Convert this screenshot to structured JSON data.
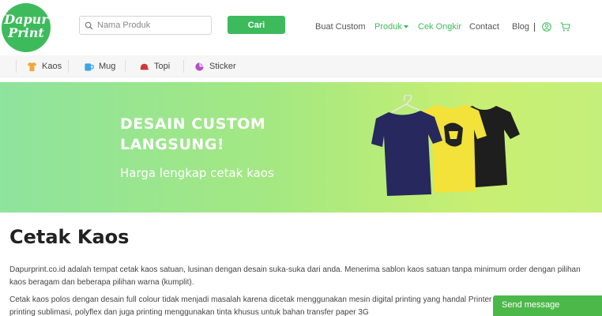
{
  "header": {
    "logo_line1": "Dapur",
    "logo_line2": "Print",
    "search_placeholder": "Nama Produk",
    "search_button": "Cari",
    "nav": [
      {
        "label": "Buat Custom"
      },
      {
        "label": "Produk"
      },
      {
        "label": "Cek Ongkir"
      },
      {
        "label": "Contact"
      },
      {
        "label": "Blog"
      }
    ],
    "accent_color": "#3dbb5c"
  },
  "categories": [
    {
      "label": "Kaos",
      "icon": "tshirt-icon"
    },
    {
      "label": "Mug",
      "icon": "mug-icon"
    },
    {
      "label": "Topi",
      "icon": "cap-icon"
    },
    {
      "label": "Sticker",
      "icon": "sticker-icon"
    }
  ],
  "banner": {
    "title_line1": "DESAIN CUSTOM",
    "title_line2": "LANGSUNG!",
    "subtitle": "Harga lengkap cetak kaos"
  },
  "content": {
    "title": "Cetak Kaos",
    "paragraph1": "Dapurprint.co.id adalah tempat cetak kaos satuan, lusinan dengan desain suka-suka dari anda. Menerima sablon kaos satuan tanpa minimum order dengan pilihan kaos beragam dan beberapa pilihan warna (kumplit).",
    "paragraph2": "Cetak kaos polos dengan desain full colour tidak menjadi masalah karena dicetak menggunakan mesin digital printing yang handal Printer DTG, printing and cut, printing sublimasi, polyflex dan juga printing menggunakan tinta khusus untuk bahan transfer paper 3G"
  },
  "chat": {
    "label": "Send message"
  }
}
